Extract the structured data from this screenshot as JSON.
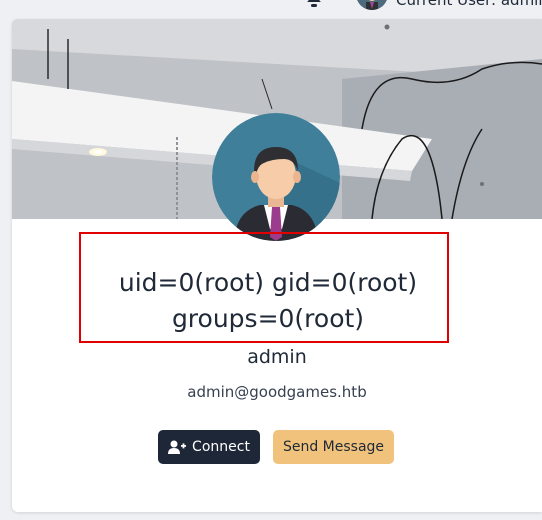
{
  "header": {
    "user_label": "Current User: admin",
    "icons": [
      "bell-icon",
      "user-avatar"
    ]
  },
  "profile": {
    "banner_image": "office-ceiling-photo",
    "avatar_image": "businessman-avatar",
    "display_name_line1": "uid=0(root) gid=0(root)",
    "display_name_line2": "groups=0(root)",
    "username": "admin",
    "email": "admin@goodgames.htb",
    "highlight_color": "#e00000"
  },
  "actions": {
    "connect_label": "Connect",
    "connect_icon": "user-plus-icon",
    "message_label": "Send Message",
    "connect_color": "#1e2737",
    "message_color": "#f0c27b"
  }
}
